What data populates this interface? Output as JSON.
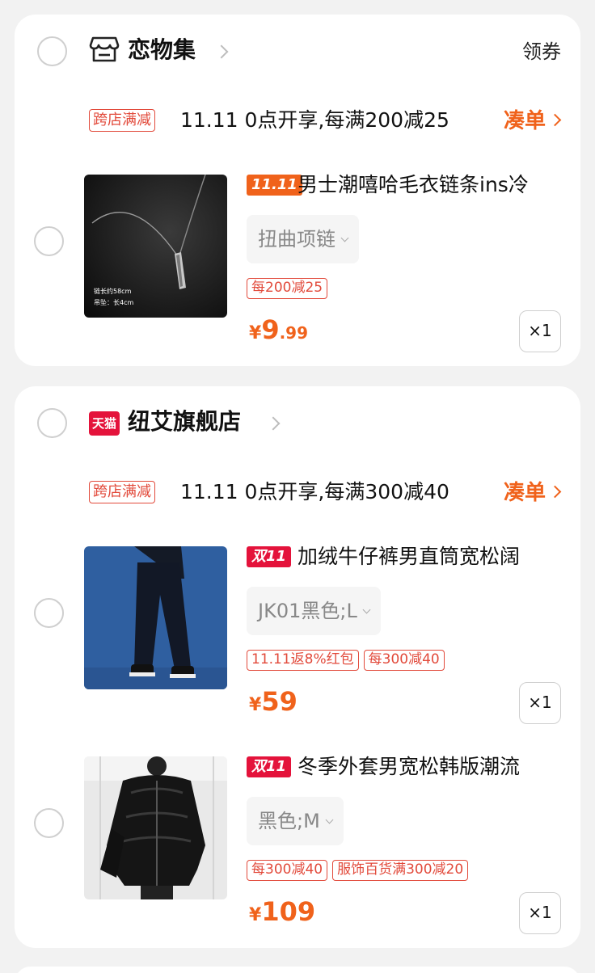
{
  "stores": [
    {
      "name": "恋物集",
      "coupon_label": "领券",
      "promo_tag": "跨店满减",
      "promo_text": "11.11 0点开享,每满200减25",
      "combine_label": "凑单",
      "items": [
        {
          "badge": "11.11",
          "title": "男士潮嘻哈毛衣链条ins冷",
          "sku": "扭曲项链",
          "tags": [
            "每200减25"
          ],
          "price_currency": "¥",
          "price_int": "9",
          "price_dec": ".99",
          "qty": "×1",
          "thumb_caption_1": "链长约58cm",
          "thumb_caption_2": "吊坠：长4cm"
        }
      ]
    },
    {
      "name": "纽艾旗舰店",
      "store_badge": "天猫",
      "promo_tag": "跨店满减",
      "promo_text": "11.11 0点开享,每满300减40",
      "combine_label": "凑单",
      "items": [
        {
          "badge": "双11",
          "title": "加绒牛仔裤男直筒宽松阔",
          "sku": "JK01黑色;L",
          "tags": [
            "11.11返8%红包",
            "每300减40"
          ],
          "price_currency": "¥",
          "price_int": "59",
          "price_dec": "",
          "qty": "×1"
        },
        {
          "badge": "双11",
          "title": "冬季外套男宽松韩版潮流",
          "sku": "黑色;M",
          "tags": [
            "每300减40",
            "服饰百货满300减20"
          ],
          "price_currency": "¥",
          "price_int": "109",
          "price_dec": "",
          "qty": "×1"
        }
      ]
    }
  ],
  "colors": {
    "accent": "#f0621b",
    "tag_red": "#e24a3b",
    "tmall_red": "#e4133b",
    "background": "#f2f2f2"
  }
}
